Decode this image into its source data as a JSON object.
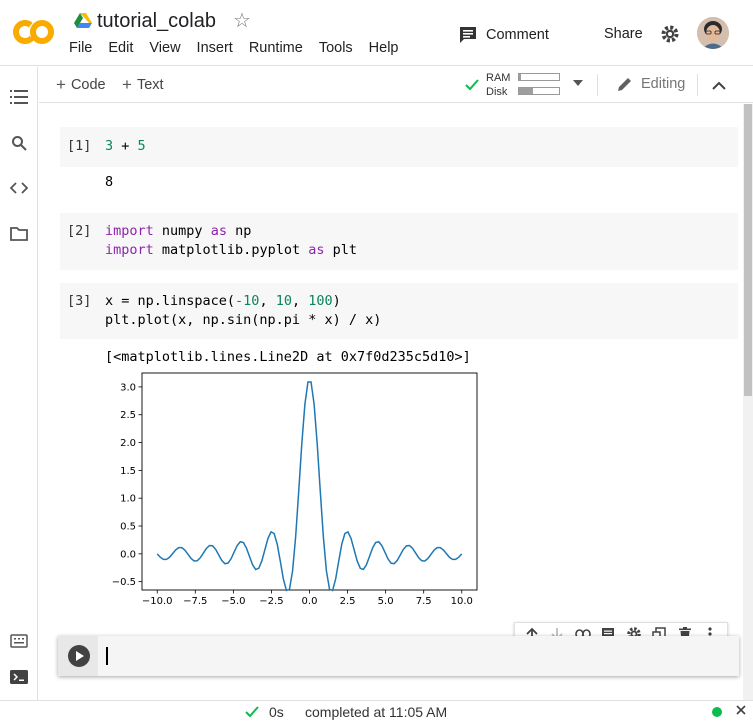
{
  "header": {
    "logo_text": "CO",
    "notebook_title": "tutorial_colab",
    "menu": [
      "File",
      "Edit",
      "View",
      "Insert",
      "Runtime",
      "Tools",
      "Help"
    ],
    "comment_label": "Comment",
    "share_label": "Share"
  },
  "toolbar": {
    "add_code": "Code",
    "add_text": "Text",
    "ram_label": "RAM",
    "disk_label": "Disk",
    "ram_usage": 0.05,
    "disk_usage": 0.35,
    "editing_label": "Editing"
  },
  "cells": [
    {
      "prompt": "[1]",
      "output": "8"
    },
    {
      "prompt": "[2]"
    },
    {
      "prompt": "[3]",
      "output": "[<matplotlib.lines.Line2D at 0x7f0d235c5d10>]"
    }
  ],
  "code_tokens": {
    "c1_l1": [
      "3",
      " + ",
      "5"
    ],
    "c2_l1": [
      "import",
      " numpy ",
      "as",
      " np"
    ],
    "c2_l2": [
      "import",
      " matplotlib.pyplot ",
      "as",
      " plt"
    ],
    "c3_l1": [
      "x = np.linspace(",
      "-10",
      ", ",
      "10",
      ", ",
      "100",
      ")"
    ],
    "c3_l2": [
      "plt.plot(x, np.sin(np.pi * x) / x)"
    ]
  },
  "chart_data": {
    "type": "line",
    "title": "",
    "xlabel": "",
    "ylabel": "",
    "xlim": [
      -11,
      11
    ],
    "ylim": [
      -0.65,
      3.25
    ],
    "xticks": [
      "−10.0",
      "−7.5",
      "−5.0",
      "−2.5",
      "0.0",
      "2.5",
      "5.0",
      "7.5",
      "10.0"
    ],
    "yticks": [
      "−0.5",
      "0.0",
      "0.5",
      "1.0",
      "1.5",
      "2.0",
      "2.5",
      "3.0"
    ],
    "line_color": "#1f77b4",
    "grid": false,
    "series": [
      {
        "function": "sin(pi*x)/x",
        "x_start": -10,
        "x_end": 10,
        "num_points": 100
      }
    ]
  },
  "status": {
    "duration": "0s",
    "completed": "completed at 11:05 AM"
  },
  "colors": {
    "logo_orange": "#f9ab00",
    "accent_green": "#0bbd4c",
    "keyword": "#8e24aa",
    "number": "#098658"
  }
}
